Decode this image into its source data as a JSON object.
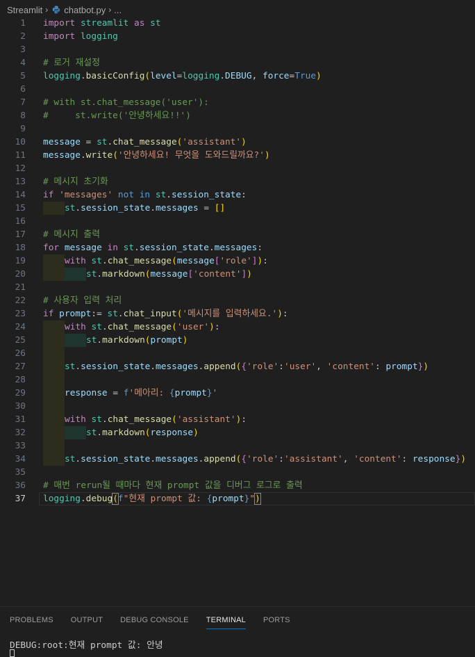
{
  "breadcrumb": {
    "folder": "Streamlit",
    "file": "chatbot.py",
    "more": "..."
  },
  "editor": {
    "active_line": 37,
    "line_numbers": [
      "1",
      "2",
      "3",
      "4",
      "5",
      "6",
      "7",
      "8",
      "9",
      "10",
      "11",
      "12",
      "13",
      "14",
      "15",
      "16",
      "17",
      "18",
      "19",
      "20",
      "21",
      "22",
      "23",
      "24",
      "25",
      "26",
      "27",
      "28",
      "29",
      "30",
      "31",
      "32",
      "33",
      "34",
      "35",
      "36",
      "37"
    ]
  },
  "code": {
    "l1_import": "import",
    "l1_mod": "streamlit",
    "l1_as": "as",
    "l1_alias": "st",
    "l2_import": "import",
    "l2_mod": "logging",
    "l4_comment": "# 로거 재설정",
    "l5_obj": "logging",
    "l5_fn": "basicConfig",
    "l5_level": "level",
    "l5_logging": "logging",
    "l5_debug": "DEBUG",
    "l5_force": "force",
    "l5_true": "True",
    "l7_comment": "# with st.chat_message('user'):",
    "l8_comment": "#     st.write('안녕하세요!!')",
    "l10_var": "message",
    "l10_st": "st",
    "l10_fn": "chat_message",
    "l10_str": "'assistant'",
    "l11_var": "message",
    "l11_fn": "write",
    "l11_str": "'안녕하세요! 무엇을 도와드릴까요?'",
    "l13_comment": "# 메시지 초기화",
    "l14_if": "if",
    "l14_str": "'messages'",
    "l14_notin": "not in",
    "l14_st": "st",
    "l14_attr": "session_state",
    "l15_st": "st",
    "l15_attr": "session_state",
    "l15_attr2": "messages",
    "l17_comment": "# 메시지 출력",
    "l18_for": "for",
    "l18_var": "message",
    "l18_in": "in",
    "l18_st": "st",
    "l18_attr": "session_state",
    "l18_attr2": "messages",
    "l19_with": "with",
    "l19_st": "st",
    "l19_fn": "chat_message",
    "l19_var": "message",
    "l19_str": "'role'",
    "l20_st": "st",
    "l20_fn": "markdown",
    "l20_var": "message",
    "l20_str": "'content'",
    "l22_comment": "# 사용자 입력 처리",
    "l23_if": "if",
    "l23_var": "prompt",
    "l23_st": "st",
    "l23_fn": "chat_input",
    "l23_str": "'메시지를 입력하세요.'",
    "l24_with": "with",
    "l24_st": "st",
    "l24_fn": "chat_message",
    "l24_str": "'user'",
    "l25_st": "st",
    "l25_fn": "markdown",
    "l25_var": "prompt",
    "l27_st": "st",
    "l27_attr": "session_state",
    "l27_attr2": "messages",
    "l27_fn": "append",
    "l27_s1": "'role'",
    "l27_s2": "'user'",
    "l27_s3": "'content'",
    "l27_var": "prompt",
    "l29_var": "response",
    "l29_f": "f",
    "l29_str": "'메아리: ",
    "l29_inner": "prompt",
    "l29_end": "'",
    "l31_with": "with",
    "l31_st": "st",
    "l31_fn": "chat_message",
    "l31_str": "'assistant'",
    "l32_st": "st",
    "l32_fn": "markdown",
    "l32_var": "response",
    "l34_st": "st",
    "l34_attr": "session_state",
    "l34_attr2": "messages",
    "l34_fn": "append",
    "l34_s1": "'role'",
    "l34_s2": "'assistant'",
    "l34_s3": "'content'",
    "l34_var": "response",
    "l36_comment": "# 매번 rerun될 때마다 현재 prompt 값을 디버그 로그로 출력",
    "l37_obj": "logging",
    "l37_fn": "debug",
    "l37_f": "f",
    "l37_str": "\"현재 prompt 값: ",
    "l37_inner": "prompt",
    "l37_end": "\""
  },
  "panel": {
    "tabs": [
      "PROBLEMS",
      "OUTPUT",
      "DEBUG CONSOLE",
      "TERMINAL",
      "PORTS"
    ],
    "active_tab": "TERMINAL",
    "terminal_output": "DEBUG:root:현재 prompt 값: 안녕"
  }
}
